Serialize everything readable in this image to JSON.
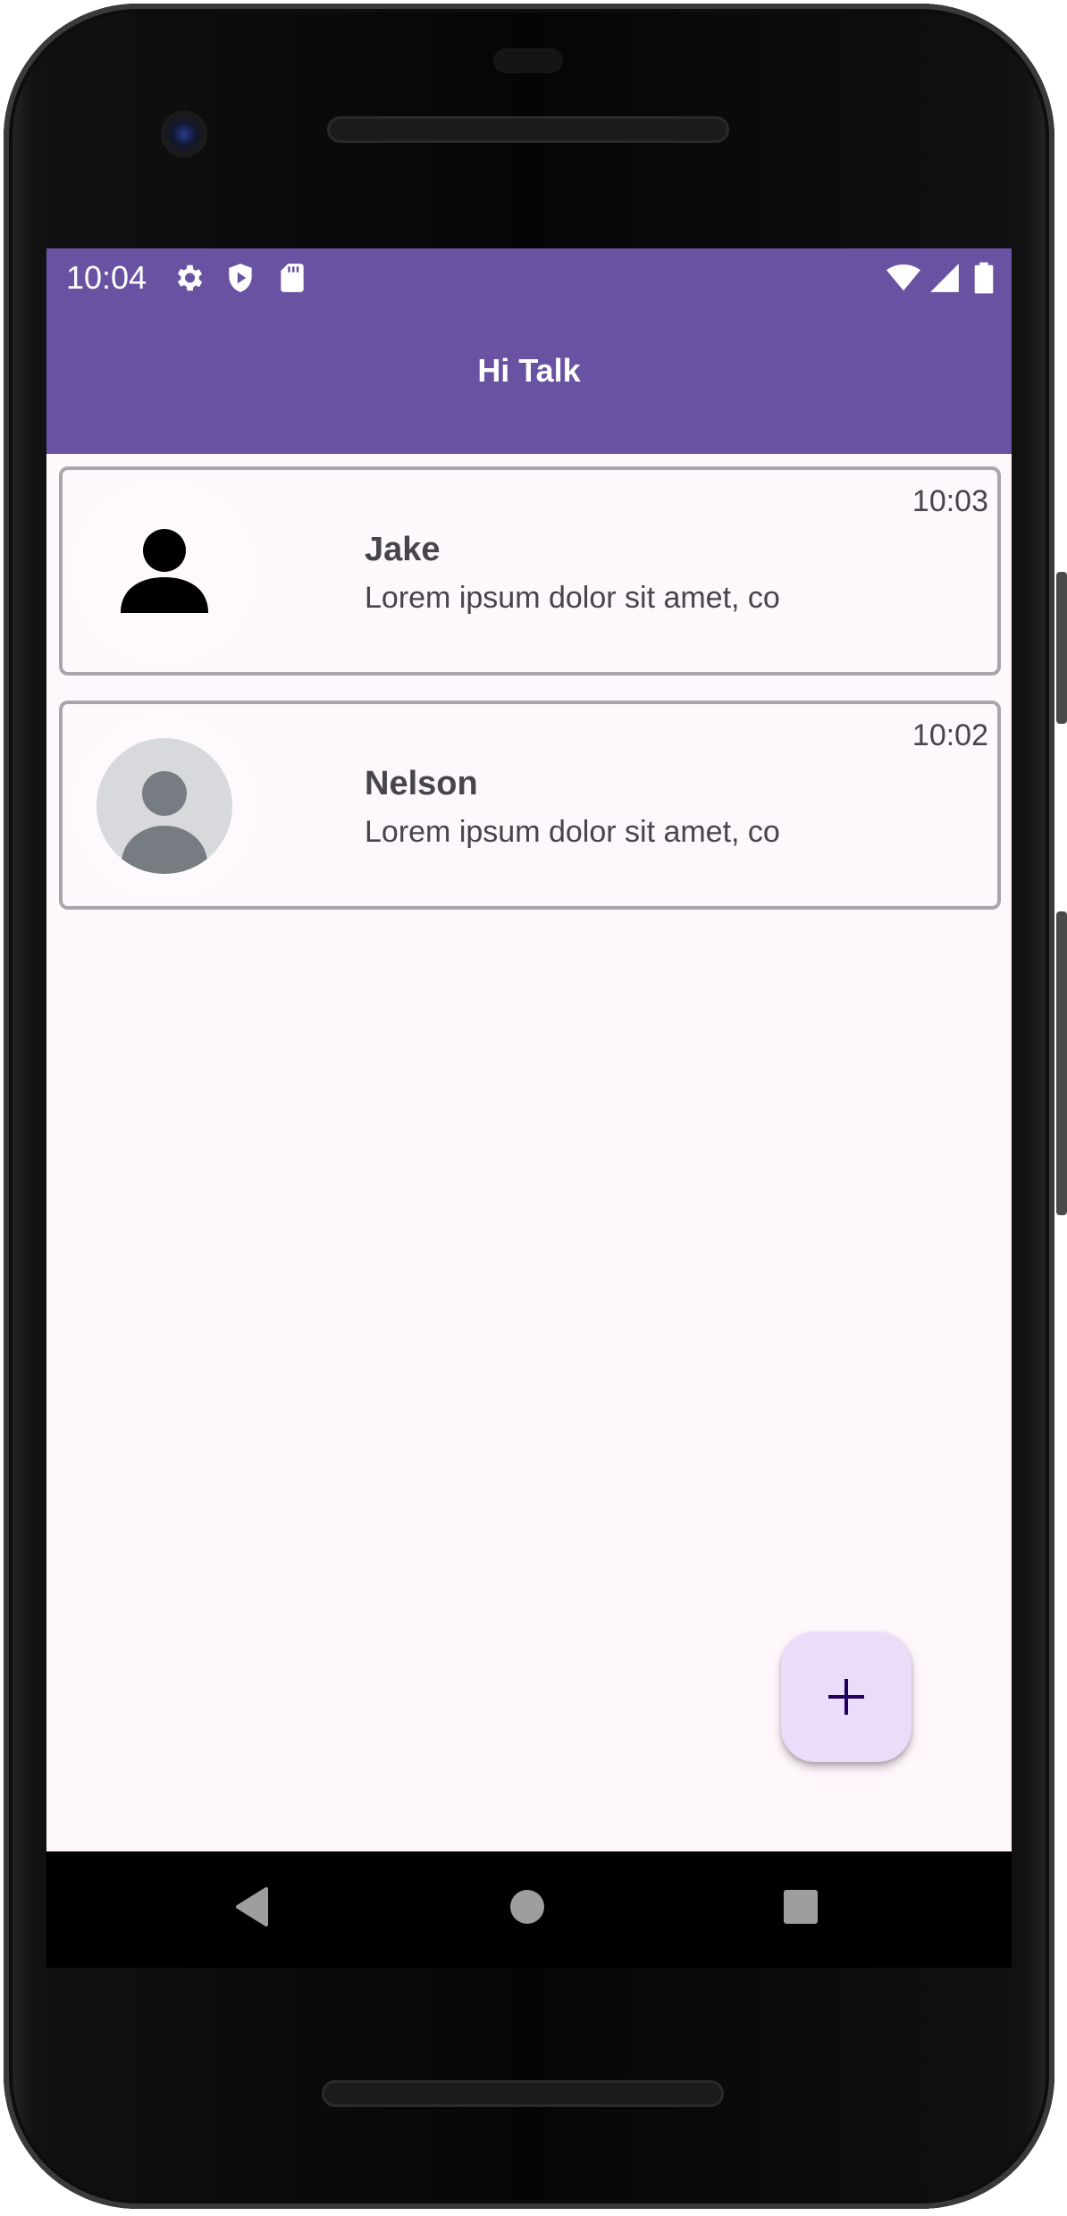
{
  "status_bar": {
    "time": "10:04",
    "left_icons": [
      "gear-icon",
      "shield-play-icon",
      "sd-card-icon"
    ],
    "right_icons": [
      "wifi-icon",
      "cell-signal-icon",
      "battery-icon"
    ]
  },
  "app_bar": {
    "title": "Hi Talk"
  },
  "chats": [
    {
      "name": "Jake",
      "message": "Lorem ipsum dolor sit amet, co",
      "time": "10:03",
      "avatar": "person-silhouette-icon"
    },
    {
      "name": "Nelson",
      "message": "Lorem ipsum dolor sit amet, co",
      "time": "10:02",
      "avatar": "default-avatar-icon"
    }
  ],
  "fab": {
    "icon": "plus-icon"
  },
  "nav_bar": {
    "buttons": [
      "back-icon",
      "home-icon",
      "recents-icon"
    ]
  },
  "colors": {
    "primary": "#6a52a3",
    "background": "#fef7fc",
    "fab": "#eaddfa",
    "text": "#46444c"
  }
}
